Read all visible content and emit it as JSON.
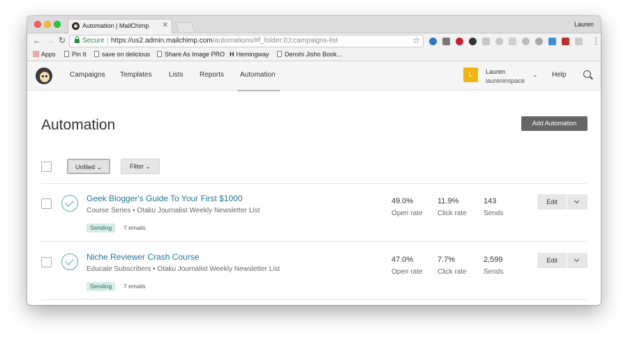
{
  "browser": {
    "tab_title": "Automation | MailChimp",
    "user": "Lauren",
    "secure_label": "Secure",
    "url_host": "https://us2.admin.mailchimp.com",
    "url_path": "/automations/#f_folder:0;t:campaigns-list",
    "bookmarks": {
      "apps": "Apps",
      "pin_it": "Pin It",
      "delicious": "save on delicious",
      "share_image": "Share As Image PRO",
      "hemingway_mark": "H",
      "hemingway": "Hemingway",
      "denshi": "Denshi Jisho Book..."
    }
  },
  "nav": {
    "campaigns": "Campaigns",
    "templates": "Templates",
    "lists": "Lists",
    "reports": "Reports",
    "automation": "Automation",
    "avatar_letter": "L",
    "account_name": "Lauren",
    "account_user": "laureninspace",
    "help": "Help"
  },
  "page": {
    "title": "Automation",
    "add_button": "Add Automation",
    "unfiled_label": "Unfiled ⌄",
    "filter_label": "Filter ⌄"
  },
  "automations": [
    {
      "name": "Geek Blogger's Guide To Your First $1000",
      "meta": "Course Series  •  Otaku Journalist Weekly Newsletter List",
      "status": "Sending",
      "emails": "7 emails",
      "open_rate": "49.0%",
      "open_label": "Open rate",
      "click_rate": "11.9%",
      "click_label": "Click rate",
      "sends": "143",
      "sends_label": "Sends",
      "edit": "Edit"
    },
    {
      "name": "Niche Reviewer Crash Course",
      "meta": "Educate Subscribers  •  Otaku Journalist Weekly Newsletter List",
      "status": "Sending",
      "emails": "7 emails",
      "open_rate": "47.0%",
      "open_label": "Open rate",
      "click_rate": "7.7%",
      "click_label": "Click rate",
      "sends": "2,599",
      "sends_label": "Sends",
      "edit": "Edit"
    }
  ]
}
